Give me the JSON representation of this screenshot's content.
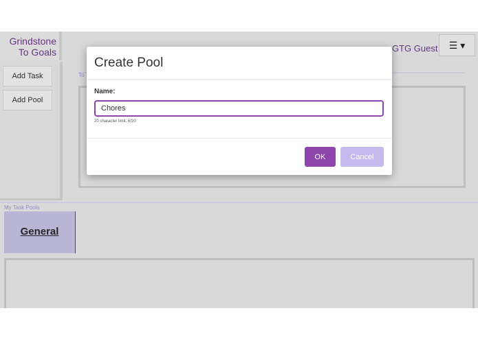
{
  "app": {
    "brand": "Grindstone To Goals",
    "user": "GTG Guest",
    "menu_icon": "☰ ▾"
  },
  "sidebar": {
    "items": [
      {
        "label": "Add Task"
      },
      {
        "label": "Add Pool"
      }
    ]
  },
  "board": {
    "label": "To"
  },
  "pools": {
    "label": "My Task Pools",
    "tabs": [
      {
        "label": "General"
      }
    ]
  },
  "modal": {
    "title": "Create Pool",
    "name_label": "Name:",
    "name_value": "Chores",
    "hint": "20 character limit. 6/20",
    "ok_label": "OK",
    "cancel_label": "Cancel"
  },
  "colors": {
    "accent": "#8e44ad",
    "brand_text": "#6a3c8c",
    "cancel": "#c5b8ec"
  }
}
